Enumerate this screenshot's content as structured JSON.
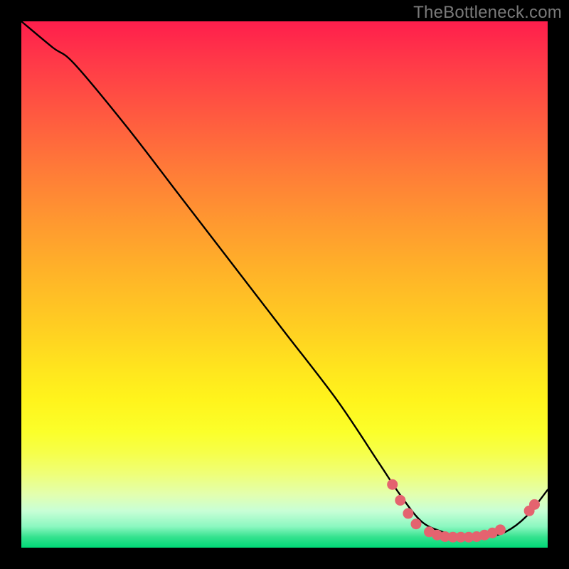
{
  "watermark": "TheBottleneck.com",
  "chart_data": {
    "type": "line",
    "title": "",
    "xlabel": "",
    "ylabel": "",
    "xlim": [
      0,
      100
    ],
    "ylim": [
      0,
      100
    ],
    "series": [
      {
        "name": "curve",
        "x": [
          0,
          6,
          10,
          20,
          30,
          40,
          50,
          60,
          68,
          72,
          76,
          80,
          84,
          88,
          92,
          96,
          100
        ],
        "y": [
          100,
          95,
          92,
          80,
          67,
          54,
          41,
          28,
          16,
          10,
          5,
          3,
          2,
          2,
          3,
          6,
          11
        ]
      }
    ],
    "markers": [
      {
        "x": 70.5,
        "y": 12.0
      },
      {
        "x": 72.0,
        "y": 9.0
      },
      {
        "x": 73.5,
        "y": 6.5
      },
      {
        "x": 75.0,
        "y": 4.5
      },
      {
        "x": 77.5,
        "y": 3.0
      },
      {
        "x": 79.0,
        "y": 2.4
      },
      {
        "x": 80.5,
        "y": 2.1
      },
      {
        "x": 82.0,
        "y": 2.0
      },
      {
        "x": 83.5,
        "y": 2.0
      },
      {
        "x": 85.0,
        "y": 2.0
      },
      {
        "x": 86.5,
        "y": 2.1
      },
      {
        "x": 88.0,
        "y": 2.4
      },
      {
        "x": 89.5,
        "y": 2.8
      },
      {
        "x": 91.0,
        "y": 3.4
      },
      {
        "x": 96.5,
        "y": 7.0
      },
      {
        "x": 97.5,
        "y": 8.2
      }
    ],
    "gradient_stops": [
      {
        "pos": 0.0,
        "color": "#ff1e4c"
      },
      {
        "pos": 0.72,
        "color": "#fff41c"
      },
      {
        "pos": 1.0,
        "color": "#00d977"
      }
    ],
    "marker_color": "#e4636f",
    "line_color": "#000000"
  }
}
